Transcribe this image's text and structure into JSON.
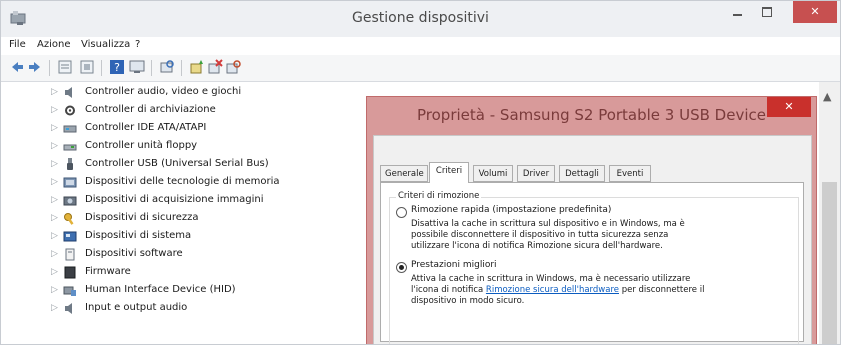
{
  "window": {
    "title": "Gestione dispositivi",
    "close_glyph": "✕",
    "app_icon": "device-manager-icon"
  },
  "menu": [
    "File",
    "Azione",
    "Visualizza",
    "?"
  ],
  "toolbar_icons": [
    "back-arrow-icon",
    "forward-arrow-icon",
    "properties-sheet-icon",
    "update-driver-icon",
    "help-icon",
    "monitor-icon",
    "scan-hardware-icon",
    "add-driver-icon",
    "uninstall-device-icon",
    "disable-device-icon"
  ],
  "tree": {
    "items": [
      {
        "label": "Controller audio, video e giochi",
        "icon": "speaker-icon"
      },
      {
        "label": "Controller di archiviazione",
        "icon": "gear-icon"
      },
      {
        "label": "Controller IDE ATA/ATAPI",
        "icon": "ide-controller-icon"
      },
      {
        "label": "Controller unità floppy",
        "icon": "floppy-controller-icon"
      },
      {
        "label": "Controller USB (Universal Serial Bus)",
        "icon": "usb-icon"
      },
      {
        "label": "Dispositivi delle tecnologie di memoria",
        "icon": "memory-icon"
      },
      {
        "label": "Dispositivi di acquisizione immagini",
        "icon": "camera-icon"
      },
      {
        "label": "Dispositivi di sicurezza",
        "icon": "key-icon"
      },
      {
        "label": "Dispositivi di sistema",
        "icon": "system-board-icon"
      },
      {
        "label": "Dispositivi software",
        "icon": "software-device-icon"
      },
      {
        "label": "Firmware",
        "icon": "firmware-icon"
      },
      {
        "label": "Human Interface Device (HID)",
        "icon": "hid-icon"
      },
      {
        "label": "Input e output audio",
        "icon": "audio-io-icon"
      }
    ]
  },
  "dialog": {
    "title": "Proprietà - Samsung S2 Portable 3 USB Device",
    "close_glyph": "✕",
    "tabs": [
      "Generale",
      "Criteri",
      "Volumi",
      "Driver",
      "Dettagli",
      "Eventi"
    ],
    "active_tab": "Criteri",
    "group_title": "Criteri di rimozione",
    "options": [
      {
        "label": "Rimozione rapida (impostazione predefinita)",
        "checked": false,
        "description": [
          "Disattiva la cache in scrittura sul dispositivo e in Windows, ma è",
          "possibile disconnettere il dispositivo in tutta sicurezza senza",
          "utilizzare l'icona di notifica Rimozione sicura dell'hardware."
        ]
      },
      {
        "label": "Prestazioni migliori",
        "checked": true,
        "description_line1": "Attiva la cache in scrittura in Windows, ma è necessario utilizzare",
        "description_line2_pre": "l'icona di notifica ",
        "description_line2_link": "Rimozione sicura dell'hardware",
        "description_line2_post": " per disconnettere il",
        "description_line3": "dispositivo in modo sicuro."
      }
    ]
  }
}
